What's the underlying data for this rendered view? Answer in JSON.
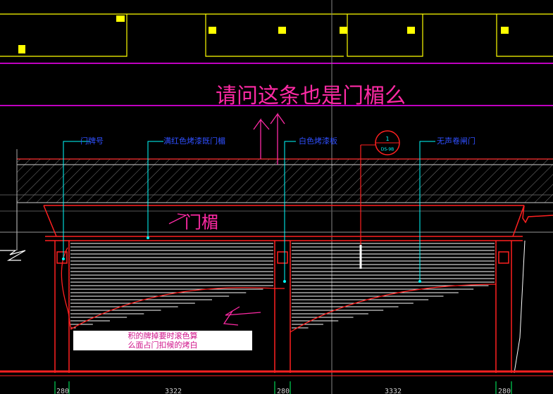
{
  "labels": {
    "door_plate": "门牌号",
    "red_paint_door_head": "满红色烤漆既门楣",
    "white_paint_board": "白色烤漆板",
    "callout_top": "1",
    "callout_bottom": "DS-9B",
    "shutter_door": "无声卷闸门"
  },
  "handwritten": {
    "question": "请问这条也是门楣么",
    "door_head": "门楣"
  },
  "note": {
    "line1": "积的牌掉要时滚色算",
    "line2": "么面占门扣候的烤白"
  },
  "dimensions": [
    "280",
    "3322",
    "280",
    "3332",
    "280"
  ],
  "colors": {
    "background": "#000000",
    "yellow": "#ffff00",
    "magenta": "#ff00ff",
    "red": "#ff2020",
    "blue_text": "#2f4fff",
    "cyan": "#00ffff",
    "white": "#ffffff",
    "handwriting": "#ff2aa5"
  }
}
